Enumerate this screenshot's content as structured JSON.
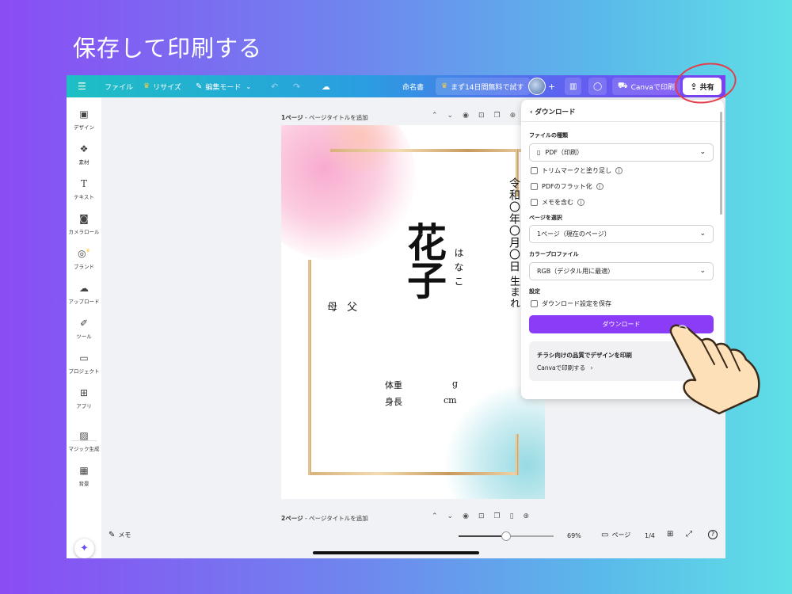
{
  "headline": "保存して印刷する",
  "topbar": {
    "menu_icon": "hamburger-icon",
    "file": "ファイル",
    "resize": "リサイズ",
    "edit_mode": "編集モード",
    "design_name": "命名書",
    "trial": "まず14日間無料で試す",
    "print": "Canvaで印刷",
    "share": "共有"
  },
  "sidebar": {
    "items": [
      {
        "label": "デザイン",
        "icon": "layout-icon"
      },
      {
        "label": "素材",
        "icon": "shapes-icon"
      },
      {
        "label": "テキスト",
        "icon": "text-icon"
      },
      {
        "label": "カメラロール",
        "icon": "camera-icon"
      },
      {
        "label": "ブランド",
        "icon": "brand-icon"
      },
      {
        "label": "アップロード",
        "icon": "upload-icon"
      },
      {
        "label": "ツール",
        "icon": "draw-icon"
      },
      {
        "label": "プロジェクト",
        "icon": "folder-icon"
      },
      {
        "label": "アプリ",
        "icon": "apps-icon"
      },
      {
        "label": "マジック生成",
        "icon": "magic-image-icon"
      },
      {
        "label": "背景",
        "icon": "background-icon"
      }
    ]
  },
  "pages": {
    "page1_num": "1ページ",
    "page1_title": " - ページタイトルを追加",
    "page2_num": "2ページ",
    "page2_title": " - ページタイトルを追加"
  },
  "design": {
    "date_top": "令和〇年〇月〇日",
    "date_bottom": "生まれ",
    "name": "花子",
    "reading": "はなこ",
    "parents": "母 父",
    "weight_label": "体重",
    "weight_unit": "g",
    "height_label": "身長",
    "height_unit": "cm"
  },
  "download_panel": {
    "title": "ダウンロード",
    "file_type_label": "ファイルの種類",
    "file_type_value": "PDF（印刷）",
    "trim_marks": "トリムマークと塗り足し",
    "flatten_pdf": "PDFのフラット化",
    "include_notes": "メモを含む",
    "select_pages_label": "ページを選択",
    "select_pages_value": "1ページ（現在のページ）",
    "color_profile_label": "カラープロファイル",
    "color_profile_value": "RGB（デジタル用に最適）",
    "settings_label": "設定",
    "save_settings": "ダウンロード設定を保存",
    "download_button": "ダウンロード",
    "promo_title": "チラシ向けの品質でデザインを印刷",
    "promo_link": "Canvaで印刷する"
  },
  "bottombar": {
    "notes": "メモ",
    "zoom": "69%",
    "zoom_fraction": 0.5,
    "pages_label": "ページ",
    "page_count": "1/4"
  },
  "colors": {
    "accent": "#8b3cf7",
    "highlight_circle": "#e43e4c"
  }
}
